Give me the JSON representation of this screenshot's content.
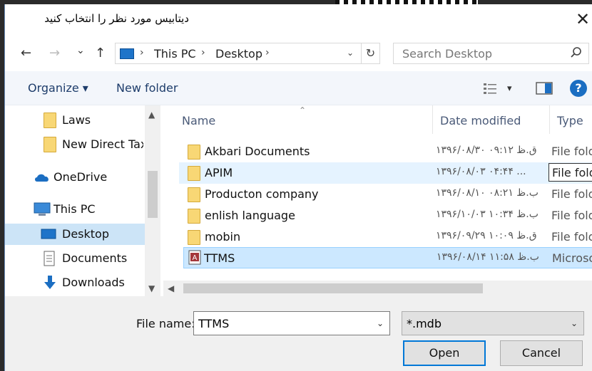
{
  "window": {
    "title": "دیتابیس مورد نظر را انتخاب کنید",
    "close_glyph": "✕"
  },
  "nav": {
    "back_glyph": "←",
    "forward_glyph": "→",
    "recent_glyph": "⌄",
    "up_glyph": "↑",
    "breadcrumb": [
      "This PC",
      "Desktop"
    ],
    "refresh_glyph": "↻",
    "search_placeholder": "Search Desktop"
  },
  "toolbar": {
    "organize_label": "Organize ▾",
    "new_folder_label": "New folder",
    "view_dd": "▾",
    "help": "?"
  },
  "sidebar": {
    "items": [
      {
        "label": "Laws",
        "icon": "folder-icon"
      },
      {
        "label": "New Direct Tax A",
        "icon": "folder-icon"
      },
      {
        "label": "OneDrive",
        "icon": "cloud-icon"
      },
      {
        "label": "This PC",
        "icon": "computer-icon"
      },
      {
        "label": "Desktop",
        "icon": "desktop-icon"
      },
      {
        "label": "Documents",
        "icon": "documents-icon"
      },
      {
        "label": "Downloads",
        "icon": "download-icon"
      }
    ]
  },
  "columns": {
    "name": "Name",
    "date": "Date modified",
    "type": "Type"
  },
  "files": [
    {
      "name": "Akbari Documents",
      "date": "۱۳۹۶/۰۸/۳۰ ق.ظ ۰۹:۱۲",
      "type": "File fold",
      "icon": "folder-icon"
    },
    {
      "name": "APIM",
      "date": "۱۳۹۶/۰۸/۰۳ ۰۴:۴۴ ...",
      "type": "File fold",
      "icon": "folder-icon"
    },
    {
      "name": "Producton company",
      "date": "۱۳۹۶/۰۸/۱۰ ب.ظ ۰۸:۲۱",
      "type": "File fold",
      "icon": "folder-icon"
    },
    {
      "name": "enlish language",
      "date": "۱۳۹۶/۱۰/۰۳ ب.ظ ۱۰:۳۴",
      "type": "File fold",
      "icon": "folder-icon"
    },
    {
      "name": "mobin",
      "date": "۱۳۹۶/۰۹/۲۹ ق.ظ ۱۰:۰۹",
      "type": "File fold",
      "icon": "folder-icon"
    },
    {
      "name": "TTMS",
      "date": "۱۳۹۶/۰۸/۱۴ ب.ظ ۱۱:۵۸",
      "type": "Microso",
      "icon": "access-db-icon"
    }
  ],
  "footer": {
    "file_name_label": "File name:",
    "file_name_value": "TTMS",
    "file_type_value": "*.mdb",
    "open_label": "Open",
    "cancel_label": "Cancel"
  },
  "colors": {
    "accent": "#0078d7",
    "selected_bg": "#cce8ff",
    "folder": "#f8d775"
  }
}
